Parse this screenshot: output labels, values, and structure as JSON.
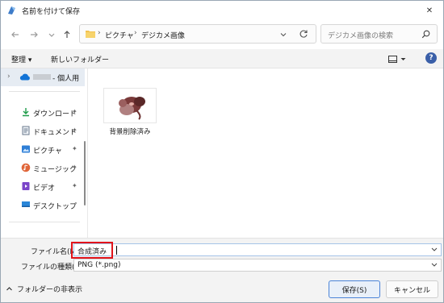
{
  "window": {
    "title": "名前を付けて保存",
    "close_label": "✕"
  },
  "address": {
    "crumbs": [
      "ピクチャ",
      "デジカメ画像"
    ],
    "separator": "›"
  },
  "search": {
    "placeholder": "デジカメ画像の検索"
  },
  "toolbar": {
    "organize_label": "整理 ▾",
    "new_folder_label": "新しいフォルダー",
    "help_label": "?"
  },
  "nav": {
    "onedrive_label": "- 個人用",
    "items": [
      {
        "label": "ダウンロード",
        "icon": "download-icon",
        "pinned": true
      },
      {
        "label": "ドキュメント",
        "icon": "document-icon",
        "pinned": true
      },
      {
        "label": "ピクチャ",
        "icon": "pictures-icon",
        "pinned": true
      },
      {
        "label": "ミュージック",
        "icon": "music-icon",
        "pinned": true
      },
      {
        "label": "ビデオ",
        "icon": "video-icon",
        "pinned": true
      },
      {
        "label": "デスクトップ",
        "icon": "desktop-icon",
        "pinned": false
      }
    ],
    "pin_glyph": "📌"
  },
  "content": {
    "files": [
      {
        "name": "背景削除済み",
        "type": "image"
      }
    ]
  },
  "form": {
    "filename_label": "ファイル名(N):",
    "filename_value": "合成済み",
    "filetype_label": "ファイルの種類(T):",
    "filetype_value": "PNG (*.png)",
    "hide_folders_label": "フォルダーの非表示",
    "save_label": "保存(S)",
    "cancel_label": "キャンセル"
  },
  "colors": {
    "highlight_border": "#e1141b",
    "accent": "#4b84d8"
  }
}
